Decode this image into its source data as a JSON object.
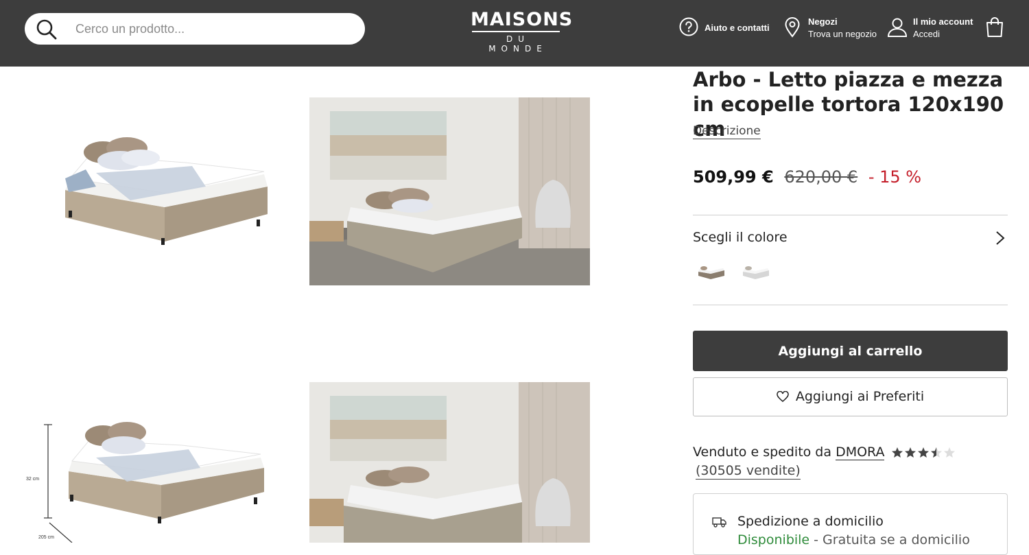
{
  "header": {
    "search_placeholder": "Cerco un prodotto...",
    "logo_top": "MAISONS",
    "logo_bottom": "DU MONDE",
    "help_label": "Aiuto e contatti",
    "stores_title": "Negozi",
    "stores_sub": "Trova un negozio",
    "account_title": "Il mio account",
    "account_sub": "Accedi",
    "icons": [
      "search-icon",
      "help-icon",
      "location-pin-icon",
      "user-icon",
      "shopping-bag-icon"
    ]
  },
  "gallery": {
    "dimension_height": "32 cm",
    "dimension_length": "205 cm"
  },
  "product": {
    "title": "Arbo - Letto piazza e mezza in ecopelle tortora 120x190 cm",
    "description_link": "Descrizione",
    "price_now": "509,99 €",
    "price_old": "620,00 €",
    "discount": "- 15 %",
    "color_label": "Scegli il colore",
    "add_to_cart": "Aggiungi al carrello",
    "add_to_favorites": "Aggiungi ai Preferiti",
    "seller_prefix": "Venduto e spedito da",
    "seller_name": "DMORA",
    "seller_rating": 3.5,
    "seller_sales": "(30505 vendite)",
    "shipping_title": "Spedizione a domicilio",
    "shipping_status": "Disponibile",
    "shipping_note": " - Gratuita se a domicilio"
  },
  "colors": {
    "header_bg": "#3d3d3d",
    "discount_red": "#c41e2a",
    "available_green": "#2e8b3a"
  }
}
